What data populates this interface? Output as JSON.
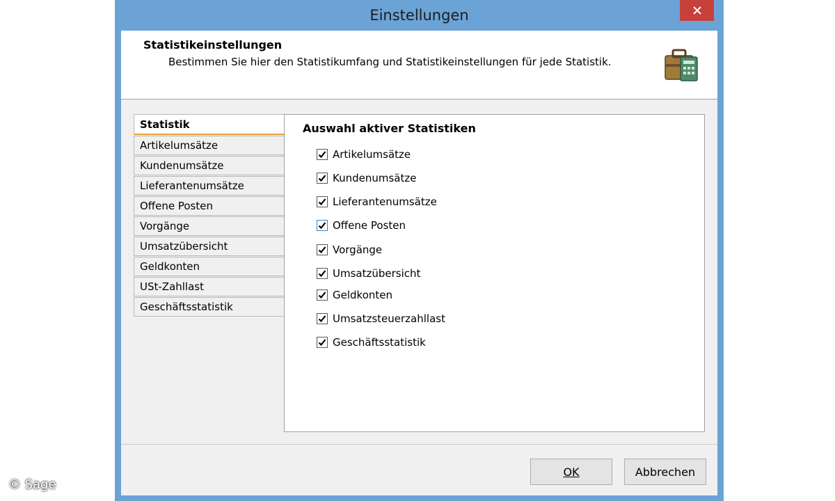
{
  "window": {
    "title": "Einstellungen",
    "close_icon": "close-icon"
  },
  "header": {
    "title": "Statistikeinstellungen",
    "description": "Bestimmen Sie hier den Statistikumfang und Statistikeinstellungen für jede Statistik.",
    "icon": "briefcase-icon"
  },
  "tabs": [
    {
      "label": "Statistik",
      "active": true
    },
    {
      "label": "Artikelumsätze",
      "active": false
    },
    {
      "label": "Kundenumsätze",
      "active": false
    },
    {
      "label": "Lieferantenumsätze",
      "active": false
    },
    {
      "label": "Offene Posten",
      "active": false
    },
    {
      "label": "Vorgänge",
      "active": false
    },
    {
      "label": "Umsatzübersicht",
      "active": false
    },
    {
      "label": "Geldkonten",
      "active": false
    },
    {
      "label": "USt-Zahllast",
      "active": false
    },
    {
      "label": "Geschäftsstatistik",
      "active": false
    }
  ],
  "panel": {
    "title": "Auswahl aktiver Statistiken",
    "checkboxes": [
      {
        "label": "Artikelumsätze",
        "checked": true
      },
      {
        "label": "Kundenumsätze",
        "checked": true
      },
      {
        "label": "Lieferantenumsätze",
        "checked": true
      },
      {
        "label": "Offene Posten",
        "checked": true,
        "focused": true
      },
      {
        "label": "Vorgänge",
        "checked": true
      },
      {
        "label": "Umsatzübersicht",
        "checked": true
      },
      {
        "label": "Geldkonten",
        "checked": true
      },
      {
        "label": "Umsatzsteuerzahllast",
        "checked": true
      },
      {
        "label": "Geschäftsstatistik",
        "checked": true
      }
    ]
  },
  "buttons": {
    "ok": "OK",
    "cancel": "Abbrechen"
  },
  "watermark": "© Sage",
  "colors": {
    "window_frame": "#6ba3d6",
    "close_button": "#c8403a",
    "active_tab_underline": "#e8a13a"
  }
}
